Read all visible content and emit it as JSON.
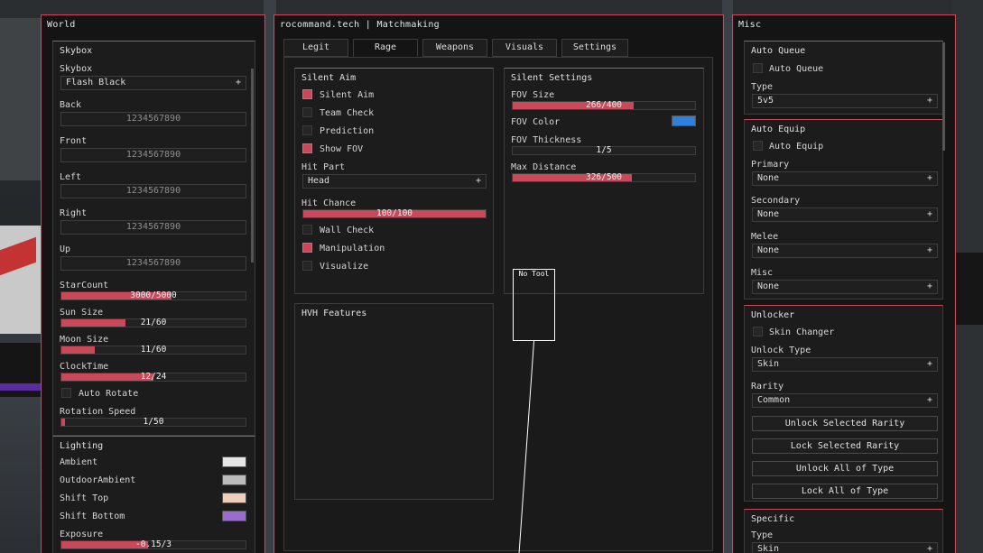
{
  "colors": {
    "accent": "#c9495a",
    "fov_color": "#2f7fdc"
  },
  "world": {
    "title": "World",
    "skybox": {
      "group_title": "Skybox",
      "skybox_label": "Skybox",
      "skybox_value": "Flash Black",
      "plus": "+",
      "faces": [
        {
          "label": "Back",
          "value": "1234567890"
        },
        {
          "label": "Front",
          "value": "1234567890"
        },
        {
          "label": "Left",
          "value": "1234567890"
        },
        {
          "label": "Right",
          "value": "1234567890"
        },
        {
          "label": "Up",
          "value": "1234567890"
        }
      ],
      "sliders": [
        {
          "label": "StarCount",
          "value": "3000/5000",
          "fraction": 0.6
        },
        {
          "label": "Sun Size",
          "value": "21/60",
          "fraction": 0.35
        },
        {
          "label": "Moon Size",
          "value": "11/60",
          "fraction": 0.18
        },
        {
          "label": "ClockTime",
          "value": "12/24",
          "fraction": 0.5
        }
      ],
      "auto_rotate": "Auto Rotate",
      "rotation_speed": {
        "label": "Rotation Speed",
        "value": "1/50",
        "fraction": 0.02
      }
    },
    "lighting": {
      "group_title": "Lighting",
      "items": [
        {
          "label": "Ambient",
          "color": "#e6e6e6"
        },
        {
          "label": "OutdoorAmbient",
          "color": "#bcbcbc"
        },
        {
          "label": "Shift Top",
          "color": "#f0cdb8"
        },
        {
          "label": "Shift Bottom",
          "color": "#9b6ccf"
        }
      ],
      "exposure": {
        "label": "Exposure",
        "value": "-0.15/3",
        "fraction": 0.47
      }
    }
  },
  "main": {
    "title": "rocommand.tech | Matchmaking",
    "tabs": [
      "Legit",
      "Rage",
      "Weapons",
      "Visuals",
      "Settings"
    ],
    "active_tab": "Rage",
    "silent_aim": {
      "group_title": "Silent Aim",
      "checks": [
        {
          "label": "Silent Aim",
          "on": true
        },
        {
          "label": "Team Check",
          "on": false
        },
        {
          "label": "Prediction",
          "on": false
        },
        {
          "label": "Show FOV",
          "on": true
        }
      ],
      "hit_part_label": "Hit Part",
      "hit_part_value": "Head",
      "plus": "+",
      "hit_chance": {
        "label": "Hit Chance",
        "value": "100/100",
        "fraction": 1.0
      },
      "checks2": [
        {
          "label": "Wall Check",
          "on": false
        },
        {
          "label": "Manipulation",
          "on": true
        },
        {
          "label": "Visualize",
          "on": false
        }
      ]
    },
    "silent_settings": {
      "group_title": "Silent Settings",
      "fov_size": {
        "label": "FOV Size",
        "value": "266/400",
        "fraction": 0.665
      },
      "fov_color_label": "FOV Color",
      "fov_thickness": {
        "label": "FOV Thickness",
        "value": "1/5",
        "fraction": 0.0
      },
      "max_distance": {
        "label": "Max Distance",
        "value": "326/500",
        "fraction": 0.652
      }
    },
    "hvh": {
      "group_title": "HVH Features"
    },
    "no_tool": "No Tool"
  },
  "misc": {
    "title": "Misc",
    "auto_queue": {
      "group_title": "Auto Queue",
      "check": "Auto Queue",
      "type_label": "Type",
      "type_value": "5v5"
    },
    "auto_equip": {
      "group_title": "Auto Equip",
      "check": "Auto Equip",
      "slots": [
        {
          "label": "Primary",
          "value": "None"
        },
        {
          "label": "Secondary",
          "value": "None"
        },
        {
          "label": "Melee",
          "value": "None"
        },
        {
          "label": "Misc",
          "value": "None"
        }
      ]
    },
    "unlocker": {
      "group_title": "Unlocker",
      "check": "Skin Changer",
      "unlock_type_label": "Unlock Type",
      "unlock_type_value": "Skin",
      "rarity_label": "Rarity",
      "rarity_value": "Common",
      "buttons": [
        "Unlock Selected Rarity",
        "Lock Selected Rarity",
        "Unlock All of Type",
        "Lock All of Type"
      ]
    },
    "specific": {
      "group_title": "Specific",
      "type_label": "Type",
      "type_value": "Skin"
    },
    "plus": "+"
  }
}
